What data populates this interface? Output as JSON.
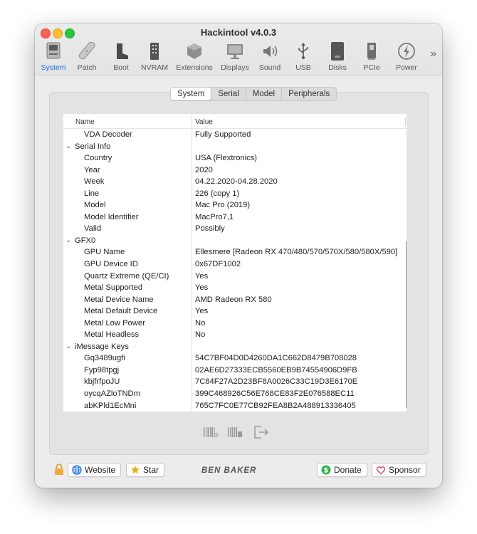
{
  "window": {
    "title": "Hackintool v4.0.3"
  },
  "toolbar": {
    "items": [
      {
        "label": "System",
        "icon": "system-icon",
        "active": true
      },
      {
        "label": "Patch",
        "icon": "patch-icon"
      },
      {
        "label": "Boot",
        "icon": "boot-icon"
      },
      {
        "label": "NVRAM",
        "icon": "nvram-icon"
      },
      {
        "label": "Extensions",
        "icon": "extensions-icon"
      },
      {
        "label": "Displays",
        "icon": "displays-icon"
      },
      {
        "label": "Sound",
        "icon": "sound-icon"
      },
      {
        "label": "USB",
        "icon": "usb-icon"
      },
      {
        "label": "Disks",
        "icon": "disks-icon"
      },
      {
        "label": "PCIe",
        "icon": "pcie-icon"
      },
      {
        "label": "Power",
        "icon": "power-icon"
      }
    ],
    "overflow": "»",
    "accent": "#1a6fe0"
  },
  "tabs": [
    {
      "label": "System",
      "selected": true
    },
    {
      "label": "Serial"
    },
    {
      "label": "Model"
    },
    {
      "label": "Peripherals"
    }
  ],
  "table": {
    "headers": {
      "name": "Name",
      "value": "Value"
    },
    "rows": [
      {
        "name": "VDA Decoder",
        "value": "Fully Supported"
      },
      {
        "name": "Serial Info",
        "value": "",
        "group": true
      },
      {
        "name": "Country",
        "value": "USA (Flextronics)"
      },
      {
        "name": "Year",
        "value": "2020"
      },
      {
        "name": "Week",
        "value": "04.22.2020-04.28.2020"
      },
      {
        "name": "Line",
        "value": "226 (copy 1)"
      },
      {
        "name": "Model",
        "value": "Mac Pro (2019)"
      },
      {
        "name": "Model Identifier",
        "value": "MacPro7,1"
      },
      {
        "name": "Valid",
        "value": "Possibly"
      },
      {
        "name": "GFX0",
        "value": "",
        "group": true
      },
      {
        "name": "GPU Name",
        "value": "Ellesmere [Radeon RX 470/480/570/570X/580/580X/590]"
      },
      {
        "name": "GPU Device ID",
        "value": "0x67DF1002"
      },
      {
        "name": "Quartz Extreme (QE/CI)",
        "value": "Yes"
      },
      {
        "name": "Metal Supported",
        "value": "Yes"
      },
      {
        "name": "Metal Device Name",
        "value": "AMD Radeon RX 580"
      },
      {
        "name": "Metal Default Device",
        "value": "Yes"
      },
      {
        "name": "Metal Low Power",
        "value": "No"
      },
      {
        "name": "Metal Headless",
        "value": "No"
      },
      {
        "name": "iMessage Keys",
        "value": "",
        "group": true
      },
      {
        "name": "Gq3489ugfi",
        "value": "54C7BF04D0D4260DA1C662D8479B708028"
      },
      {
        "name": "Fyp98tpgj",
        "value": "02AE6D27333ECB5560EB9B74554906D9FB"
      },
      {
        "name": "kbjfrfpoJU",
        "value": "7C84F27A2D23BF8A0026C33C19D3E6170E"
      },
      {
        "name": "oycqAZloTNDm",
        "value": "399C468926C56E768CE83F2E076588EC11"
      },
      {
        "name": "abKPld1EcMni",
        "value": "765C7FC0E77CB92FEA8B2A488913336405"
      }
    ]
  },
  "bottom_actions": [
    "barcode-icon",
    "barcode-alt-icon",
    "export-icon"
  ],
  "footer": {
    "website_label": "Website",
    "star_label": "Star",
    "brand": "BEN BAKER",
    "donate_label": "Donate",
    "sponsor_label": "Sponsor"
  }
}
